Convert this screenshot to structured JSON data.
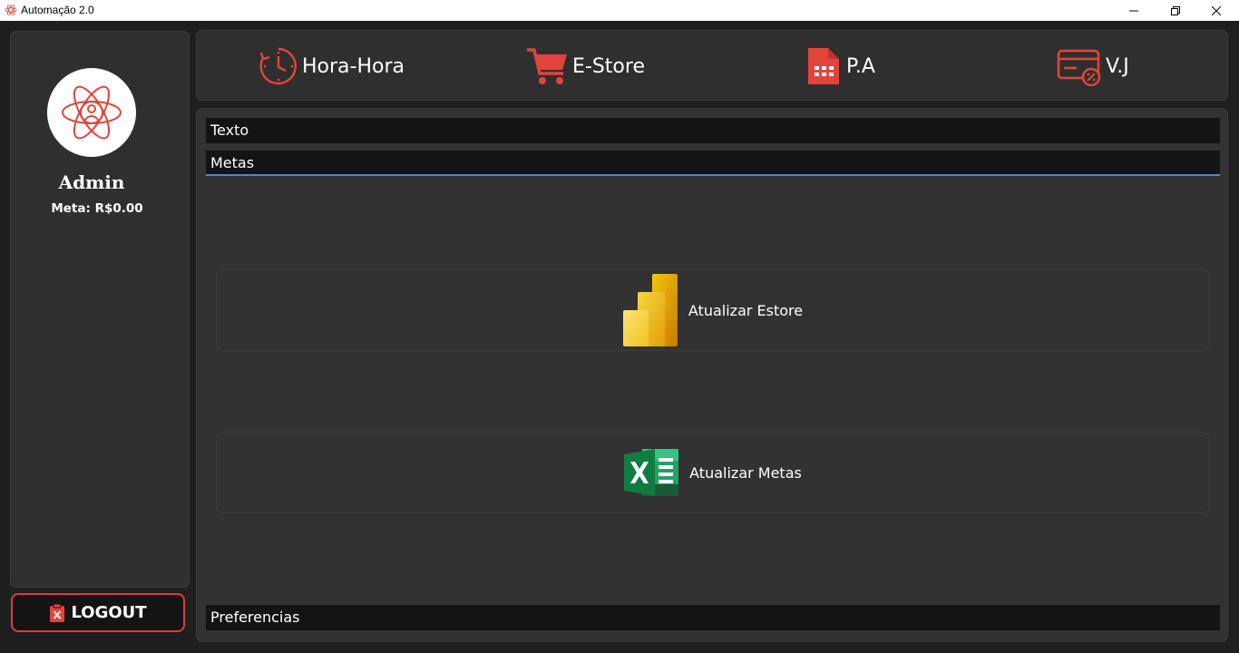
{
  "window": {
    "title": "Automação 2.0",
    "icon": "atom-icon",
    "controls": [
      "minimize-icon",
      "restore-icon",
      "close-icon"
    ]
  },
  "sidebar": {
    "avatar_icon": "atom-user-icon",
    "user_name": "Admin",
    "meta_label": "Meta:",
    "meta_value": "R$0.00",
    "logout_icon": "clipboard-x-icon",
    "logout_label": "LOGOUT"
  },
  "nav": {
    "items": [
      {
        "label": "Hora-Hora",
        "icon": "clock-icon"
      },
      {
        "label": "E-Store",
        "icon": "shopping-cart-icon"
      },
      {
        "label": "P.A",
        "icon": "spreadsheet-file-icon"
      },
      {
        "label": "V.J",
        "icon": "credit-card-percent-icon"
      }
    ]
  },
  "main": {
    "sections": {
      "texto": "Texto",
      "metas": "Metas",
      "preferencias": "Preferencias"
    },
    "actions": [
      {
        "label": "Atualizar Estore",
        "icon": "power-bi-icon"
      },
      {
        "label": "Atualizar Metas",
        "icon": "excel-icon"
      }
    ]
  },
  "colors": {
    "accent_red": "#e2443b",
    "active_underline": "#4e86d6",
    "panel_bg": "#2f2f2f",
    "header_bg": "#141414"
  }
}
